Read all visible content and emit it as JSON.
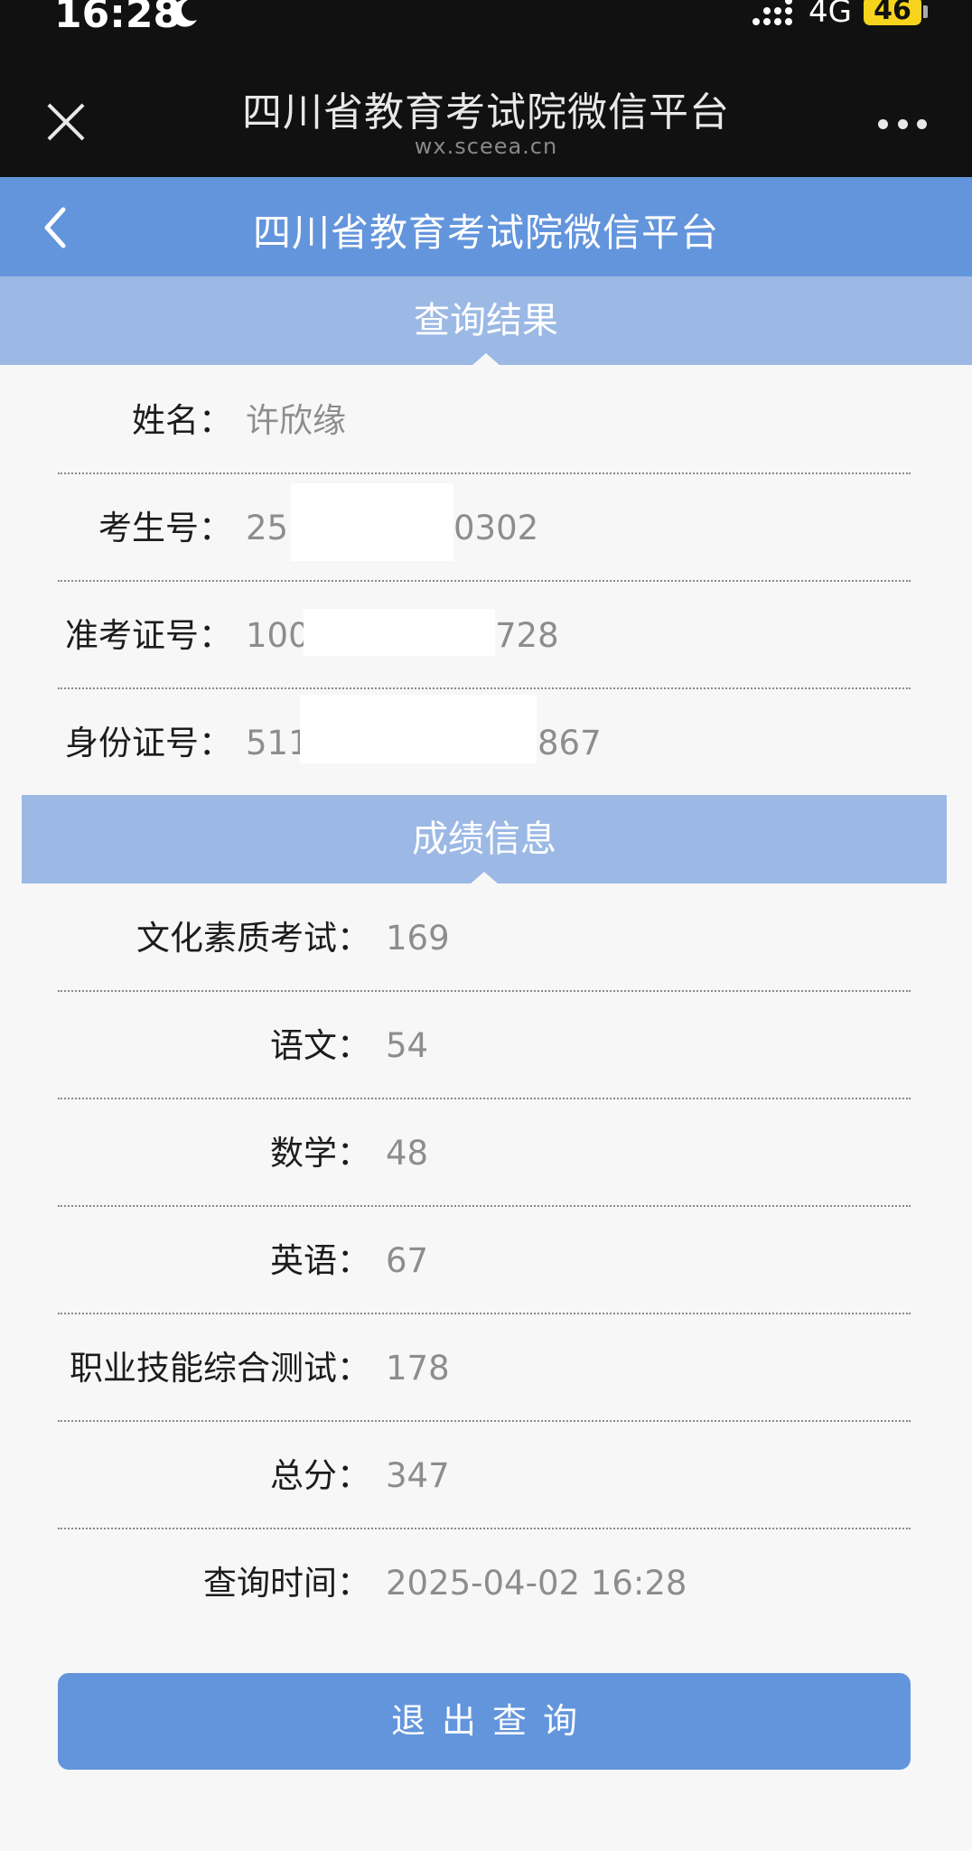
{
  "status_bar": {
    "time": "16:28",
    "network": "4G",
    "battery": "46"
  },
  "wechat_nav": {
    "title": "四川省教育考试院微信平台",
    "url": "wx.sceea.cn"
  },
  "page": {
    "title": "四川省教育考试院微信平台"
  },
  "query_result": {
    "heading": "查询结果",
    "rows": [
      {
        "label": "姓名：",
        "value": "许欣缘"
      },
      {
        "label": "考生号：",
        "value_prefix": "255",
        "value_suffix": "0302"
      },
      {
        "label": "准考证号：",
        "value_prefix": "100",
        "value_suffix": "728"
      },
      {
        "label": "身份证号：",
        "value_prefix": "511",
        "value_suffix": "867"
      }
    ]
  },
  "score_info": {
    "heading": "成绩信息",
    "rows": [
      {
        "label": "文化素质考试：",
        "value": "169"
      },
      {
        "label": "语文：",
        "value": "54"
      },
      {
        "label": "数学：",
        "value": "48"
      },
      {
        "label": "英语：",
        "value": "67"
      },
      {
        "label": "职业技能综合测试：",
        "value": "178"
      },
      {
        "label": "总分：",
        "value": "347"
      },
      {
        "label": "查询时间：",
        "value": "2025-04-02 16:28"
      }
    ]
  },
  "actions": {
    "exit_label": "退出查询"
  },
  "colors": {
    "header_blue": "#6395dc",
    "section_blue": "#9cb9e5",
    "battery_yellow": "#f6d31c"
  }
}
